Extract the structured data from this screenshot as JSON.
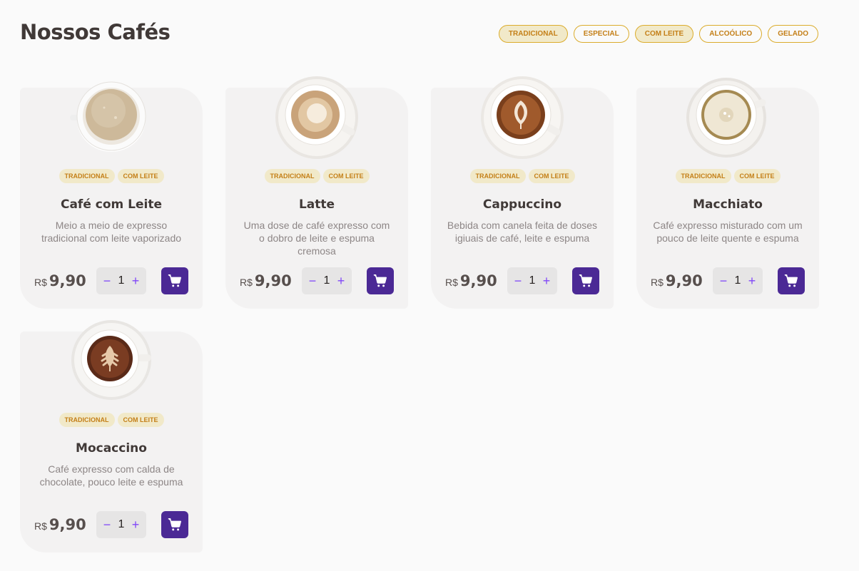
{
  "header": {
    "title": "Nossos Cafés",
    "filters": [
      {
        "label": "TRADICIONAL",
        "active": true
      },
      {
        "label": "ESPECIAL",
        "active": false
      },
      {
        "label": "COM LEITE",
        "active": true
      },
      {
        "label": "ALCOÓLICO",
        "active": false
      },
      {
        "label": "GELADO",
        "active": false
      }
    ]
  },
  "currency": "R$",
  "products": [
    {
      "image": "cafe-com-leite-cup",
      "tags": [
        "TRADICIONAL",
        "COM LEITE"
      ],
      "name": "Café com Leite",
      "description": "Meio a meio de expresso tradicional com leite vaporizado",
      "price": "9,90",
      "quantity": "1"
    },
    {
      "image": "latte-cup",
      "tags": [
        "TRADICIONAL",
        "COM LEITE"
      ],
      "name": "Latte",
      "description": "Uma dose de café expresso com o dobro de leite e espuma cremosa",
      "price": "9,90",
      "quantity": "1"
    },
    {
      "image": "cappuccino-cup",
      "tags": [
        "TRADICIONAL",
        "COM LEITE"
      ],
      "name": "Cappuccino",
      "description": "Bebida com canela feita de doses igiuais de café, leite e espuma",
      "price": "9,90",
      "quantity": "1"
    },
    {
      "image": "macchiato-cup",
      "tags": [
        "TRADICIONAL",
        "COM LEITE"
      ],
      "name": "Macchiato",
      "description": "Café expresso misturado com um pouco de leite quente e espuma",
      "price": "9,90",
      "quantity": "1"
    },
    {
      "image": "mocaccino-cup",
      "tags": [
        "TRADICIONAL",
        "COM LEITE"
      ],
      "name": "Mocaccino",
      "description": "Café expresso com calda de chocolate, pouco leite e espuma",
      "price": "9,90",
      "quantity": "1"
    }
  ],
  "icons": {
    "minus": "minus-icon",
    "plus": "plus-icon",
    "cart": "shopping-cart-icon"
  },
  "colors": {
    "background": "#fafafa",
    "card": "#f3f2f2",
    "tag_bg": "#f1e9c9",
    "tag_text": "#c47f17",
    "accent_purple": "#8047f8",
    "cart_button": "#4b2995",
    "title": "#403937"
  }
}
